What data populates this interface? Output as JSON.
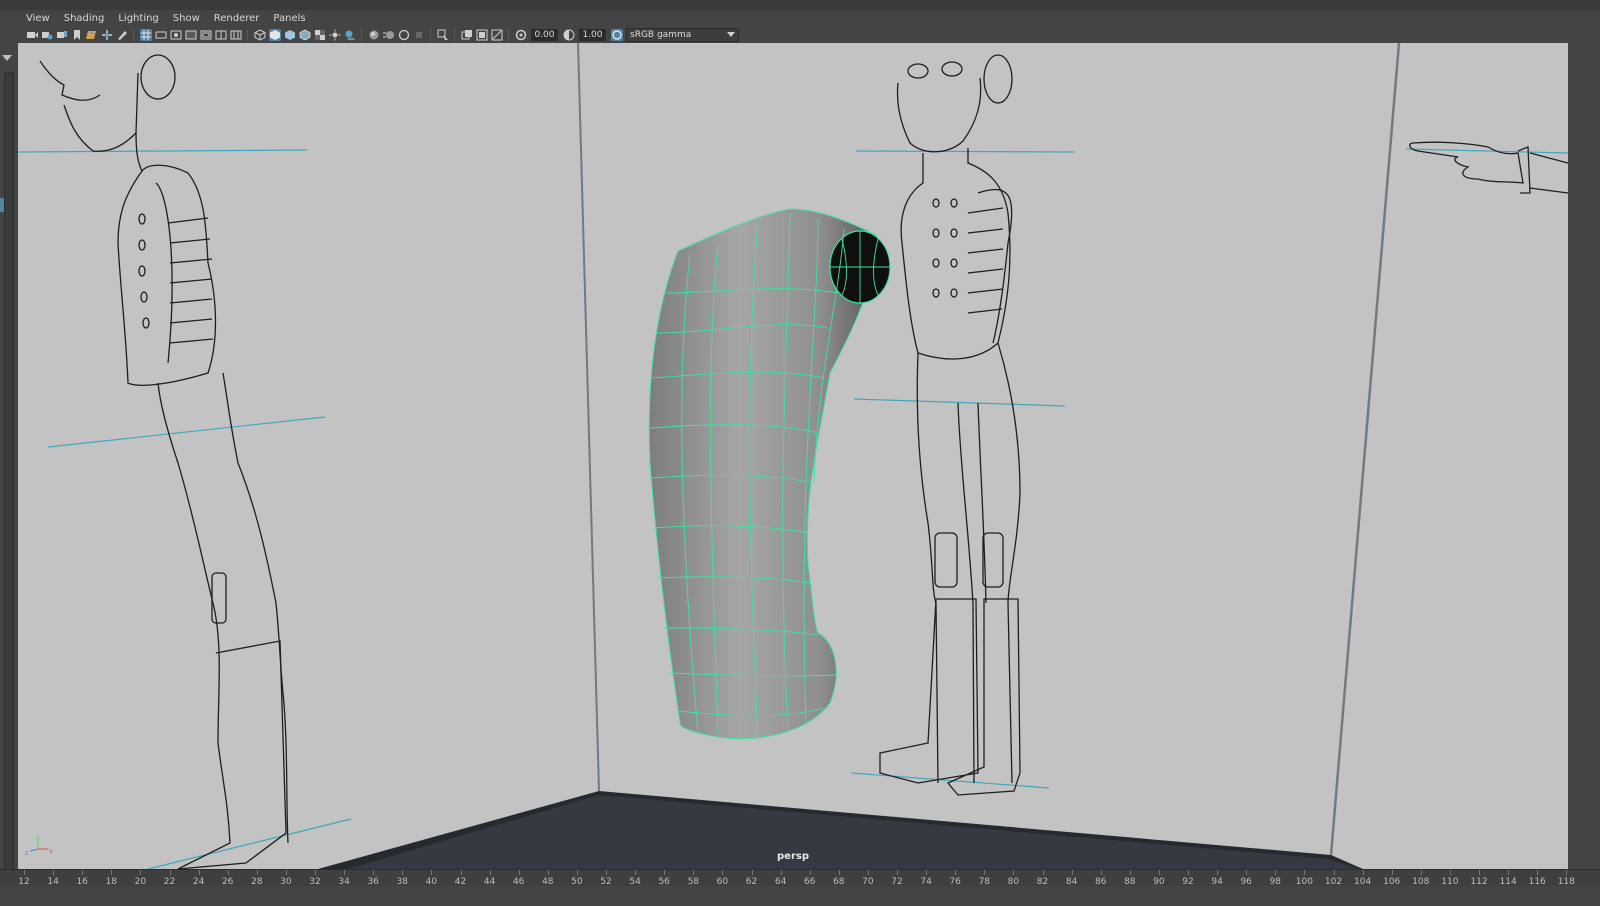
{
  "menu": [
    "View",
    "Shading",
    "Lighting",
    "Show",
    "Renderer",
    "Panels"
  ],
  "toolbar": {
    "exposure": "0.00",
    "gamma": "1.00",
    "color_space": "sRGB gamma",
    "icons_group1": [
      "select-camera-icon",
      "camera-attributes-icon",
      "bookmarks-icon",
      "bookmark-icon",
      "image-plane-icon",
      "two-d-pan-zoom-icon",
      "grease-pencil-icon"
    ],
    "icons_group2": [
      "grid-icon",
      "film-gate-icon",
      "resolution-gate-icon",
      "gate-mask-icon",
      "field-chart-icon",
      "safe-action-icon",
      "safe-title-icon"
    ],
    "icons_group3": [
      "wireframe-icon",
      "smooth-shade-icon",
      "default-material-icon",
      "wireframe-on-shaded-icon",
      "textured-icon",
      "use-all-lights-icon",
      "shadows-icon"
    ],
    "icons_group4": [
      "screen-space-ao-icon",
      "motion-blur-icon",
      "anti-aliasing-icon",
      "depth-of-field-icon"
    ],
    "icons_group5": [
      "isolate-select-icon",
      "xray-icon",
      "xray-joints-icon",
      "xray-active-components-icon"
    ]
  },
  "viewport": {
    "camera": "persp",
    "background_color": "#c3c3c3",
    "wire_color": "#3fe3a0",
    "guide_color": "#43a7bb",
    "axis_labels": {
      "y": "y",
      "z": "z",
      "x": "x"
    }
  },
  "timeline": {
    "ticks": [
      "12",
      "14",
      "16",
      "18",
      "20",
      "22",
      "24",
      "26",
      "28",
      "30",
      "32",
      "34",
      "36",
      "38",
      "40",
      "42",
      "44",
      "46",
      "48",
      "50",
      "52",
      "54",
      "56",
      "58",
      "60",
      "62",
      "64",
      "66",
      "68",
      "70",
      "72",
      "74",
      "76",
      "78",
      "80",
      "82",
      "84",
      "86",
      "88",
      "90",
      "92",
      "94",
      "96",
      "98",
      "100",
      "102",
      "104",
      "106",
      "108",
      "110",
      "112",
      "114",
      "116",
      "118"
    ]
  }
}
